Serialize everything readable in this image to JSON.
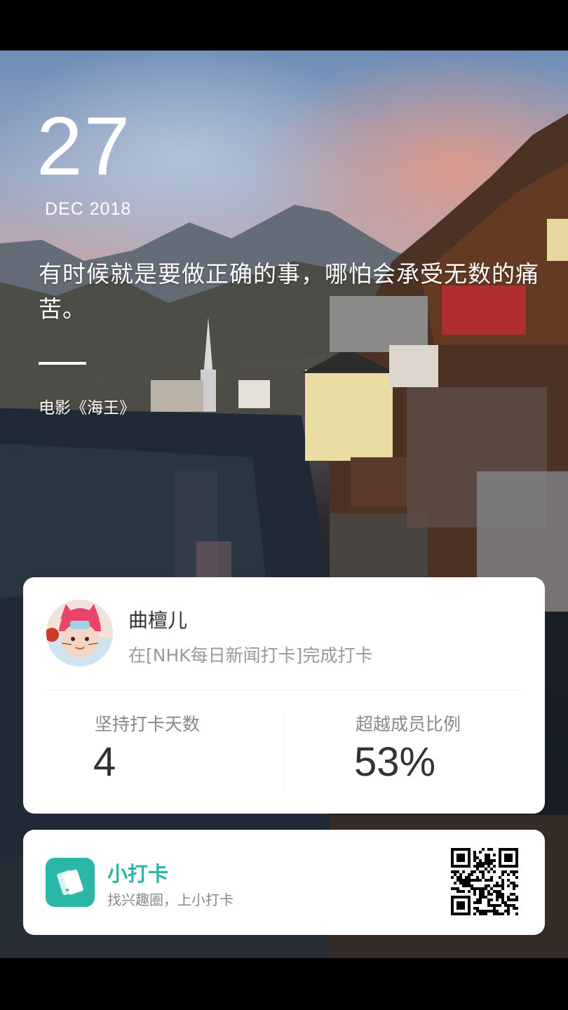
{
  "date": {
    "day": "27",
    "month_year": "DEC 2018"
  },
  "quote": {
    "text": "有时候就是要做正确的事，哪怕会承受无数的痛苦。",
    "source": "电影《海王》"
  },
  "checkin_card": {
    "user_name": "曲檀儿",
    "status": "在[NHK每日新闻打卡]完成打卡",
    "days_label": "坚持打卡天数",
    "days_value": "4",
    "percent_label": "超越成员比例",
    "percent_value": "53%"
  },
  "brand_card": {
    "app_name": "小打卡",
    "slogan": "找兴趣圈，上小打卡"
  },
  "colors": {
    "accent": "#2bb7a8",
    "card_bg": "#ffffff",
    "text_primary": "#333333",
    "text_secondary": "#999999"
  },
  "icons": [
    "app-logo-icon",
    "qr-code-icon"
  ]
}
